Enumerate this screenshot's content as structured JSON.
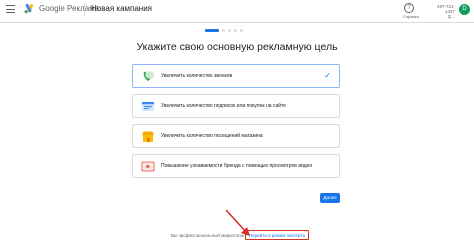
{
  "header": {
    "brand": "Google Реклама",
    "page_title": "Новая кампания",
    "help_label": "Справка",
    "account_id": "497-721-1447",
    "account_sub": "Q...",
    "avatar_initial": "D"
  },
  "main": {
    "heading": "Укажите свою основную рекламную цель",
    "goals": [
      {
        "label": "Увеличить количество звонков",
        "icon": "phone-icon",
        "selected": true
      },
      {
        "label": "Увеличить количество подписок или покупок на сайте",
        "icon": "website-icon",
        "selected": false
      },
      {
        "label": "Увеличить количество посещений магазина",
        "icon": "store-icon",
        "selected": false
      },
      {
        "label": "Повышение узнаваемости бренда с помощью просмотров видео",
        "icon": "video-icon",
        "selected": false
      }
    ],
    "check_glyph": "✓",
    "next_label": "Далее"
  },
  "footer": {
    "prompt": "Вы профессиональный маркетолог?",
    "expert_link": "Перейти в режим эксперта"
  },
  "colors": {
    "accent": "#1a73e8",
    "highlight": "#d93025"
  }
}
